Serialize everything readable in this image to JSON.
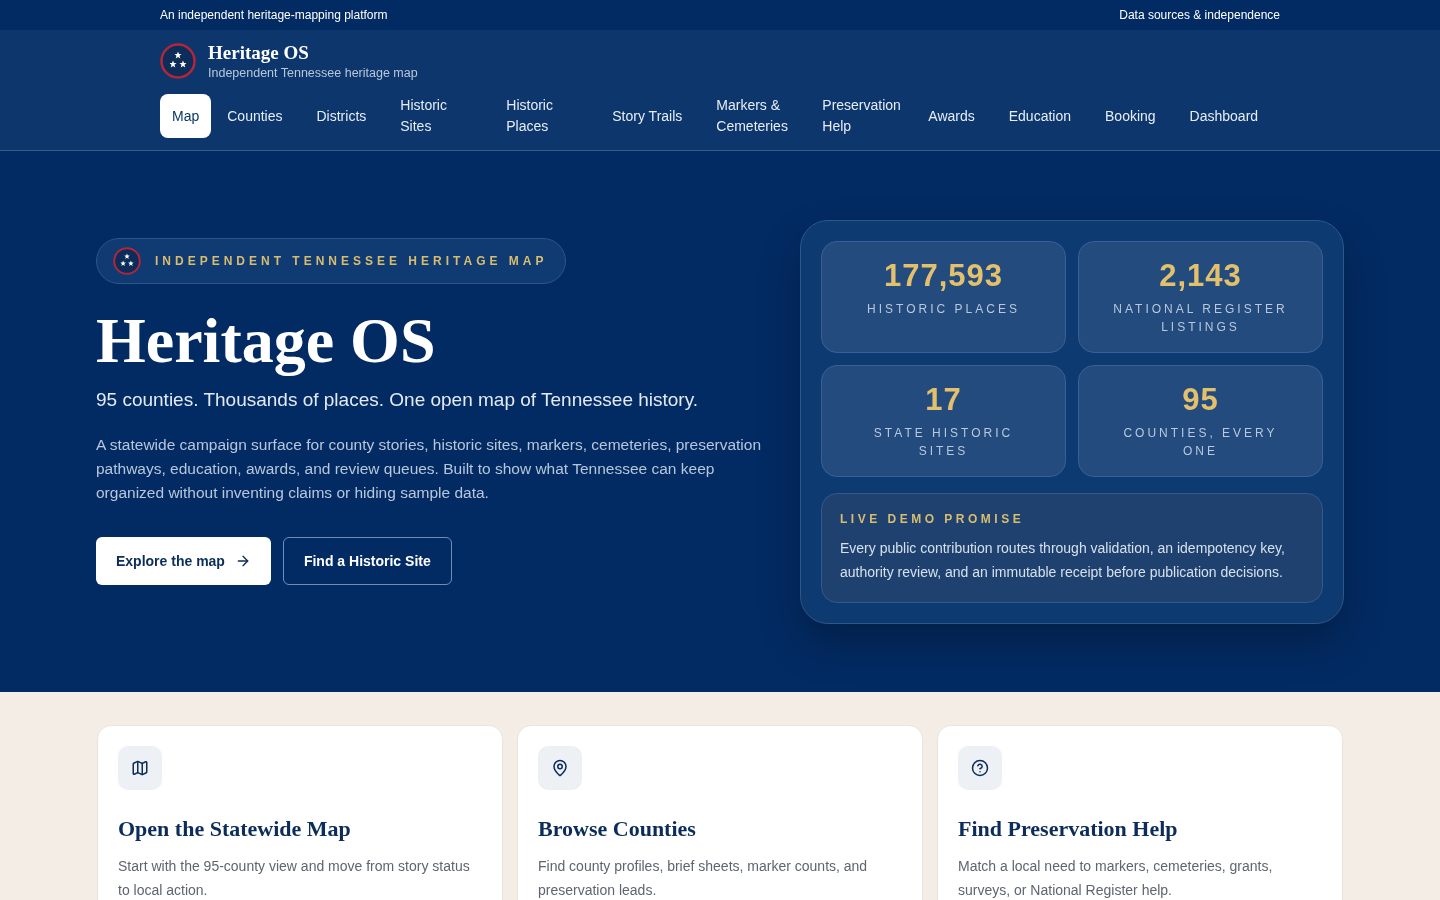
{
  "top_bar": {
    "tagline": "An independent heritage-mapping platform",
    "link": "Data sources & independence"
  },
  "brand": {
    "title": "Heritage OS",
    "subtitle": "Independent Tennessee heritage map"
  },
  "nav": [
    {
      "label": "Map",
      "selected": true
    },
    {
      "label": "Counties",
      "selected": false
    },
    {
      "label": "Districts",
      "selected": false
    },
    {
      "label": "Historic Sites",
      "selected": false
    },
    {
      "label": "Historic Places",
      "selected": false
    },
    {
      "label": "Story Trails",
      "selected": false
    },
    {
      "label": "Markers & Cemeteries",
      "selected": false
    },
    {
      "label": "Preservation Help",
      "selected": false
    },
    {
      "label": "Awards",
      "selected": false
    },
    {
      "label": "Education",
      "selected": false
    },
    {
      "label": "Booking",
      "selected": false
    },
    {
      "label": "Dashboard",
      "selected": false
    }
  ],
  "hero": {
    "eyebrow": "INDEPENDENT TENNESSEE HERITAGE MAP",
    "title": "Heritage OS",
    "lead": "95 counties. Thousands of places. One open map of Tennessee history.",
    "body": "A statewide campaign surface for county stories, historic sites, markers, cemeteries, preservation pathways, education, awards, and review queues. Built to show what Tennessee can keep organized without inventing claims or hiding sample data.",
    "primary_button": "Explore the map",
    "secondary_button": "Find a Historic Site"
  },
  "stats": [
    {
      "value": "177,593",
      "label": "HISTORIC PLACES"
    },
    {
      "value": "2,143",
      "label": "NATIONAL REGISTER LISTINGS"
    },
    {
      "value": "17",
      "label": "STATE HISTORIC SITES"
    },
    {
      "value": "95",
      "label": "COUNTIES, EVERY ONE"
    }
  ],
  "promise": {
    "heading": "LIVE DEMO PROMISE",
    "text": "Every public contribution routes through validation, an idempotency key, authority review, and an immutable receipt before publication decisions."
  },
  "cards": [
    {
      "title": "Open the Statewide Map",
      "text": "Start with the 95-county view and move from story status to local action."
    },
    {
      "title": "Browse Counties",
      "text": "Find county profiles, brief sheets, marker counts, and preservation leads."
    },
    {
      "title": "Find Preservation Help",
      "text": "Match a local need to markers, cemeteries, grants, surveys, or National Register help."
    }
  ]
}
